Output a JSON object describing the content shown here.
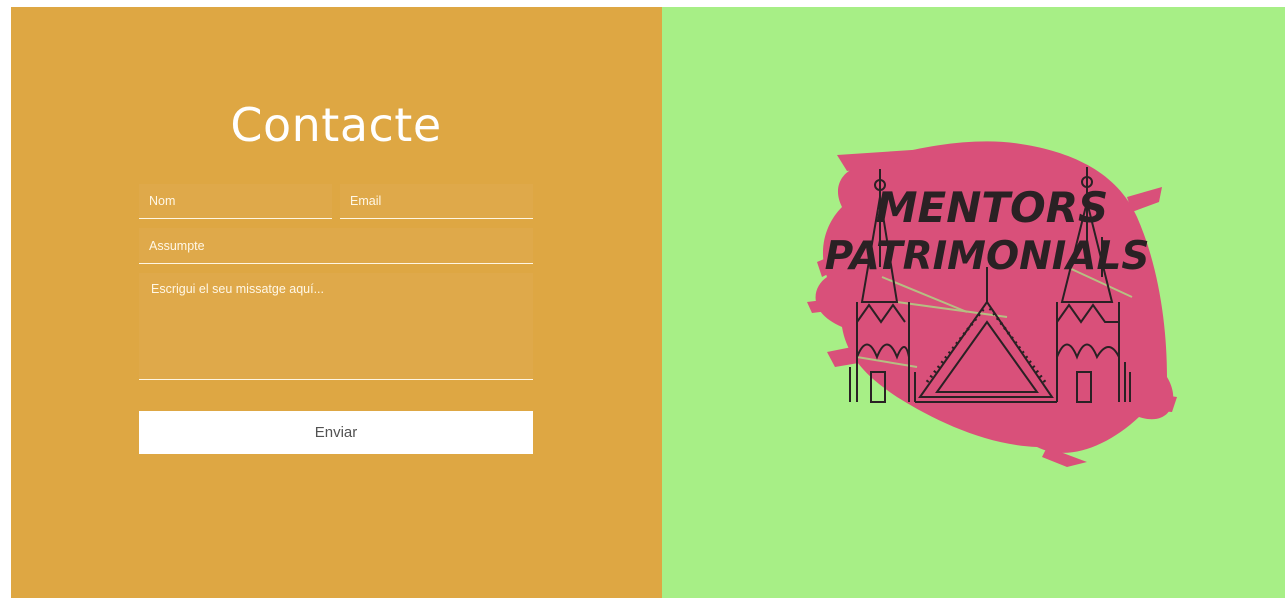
{
  "contact": {
    "title": "Contacte",
    "name_placeholder": "Nom",
    "email_placeholder": "Email",
    "subject_placeholder": "Assumpte",
    "message_placeholder": "Escrigui el seu missatge aquí...",
    "send_label": "Enviar"
  },
  "logo": {
    "line1": "MENTORS",
    "line2": "PATRIMONIALS",
    "icon": "cathedral-icon"
  },
  "colors": {
    "left_panel": "#dea743",
    "right_panel": "#a7ef86",
    "brush": "#d9507a",
    "logo_ink": "#2a2124"
  }
}
